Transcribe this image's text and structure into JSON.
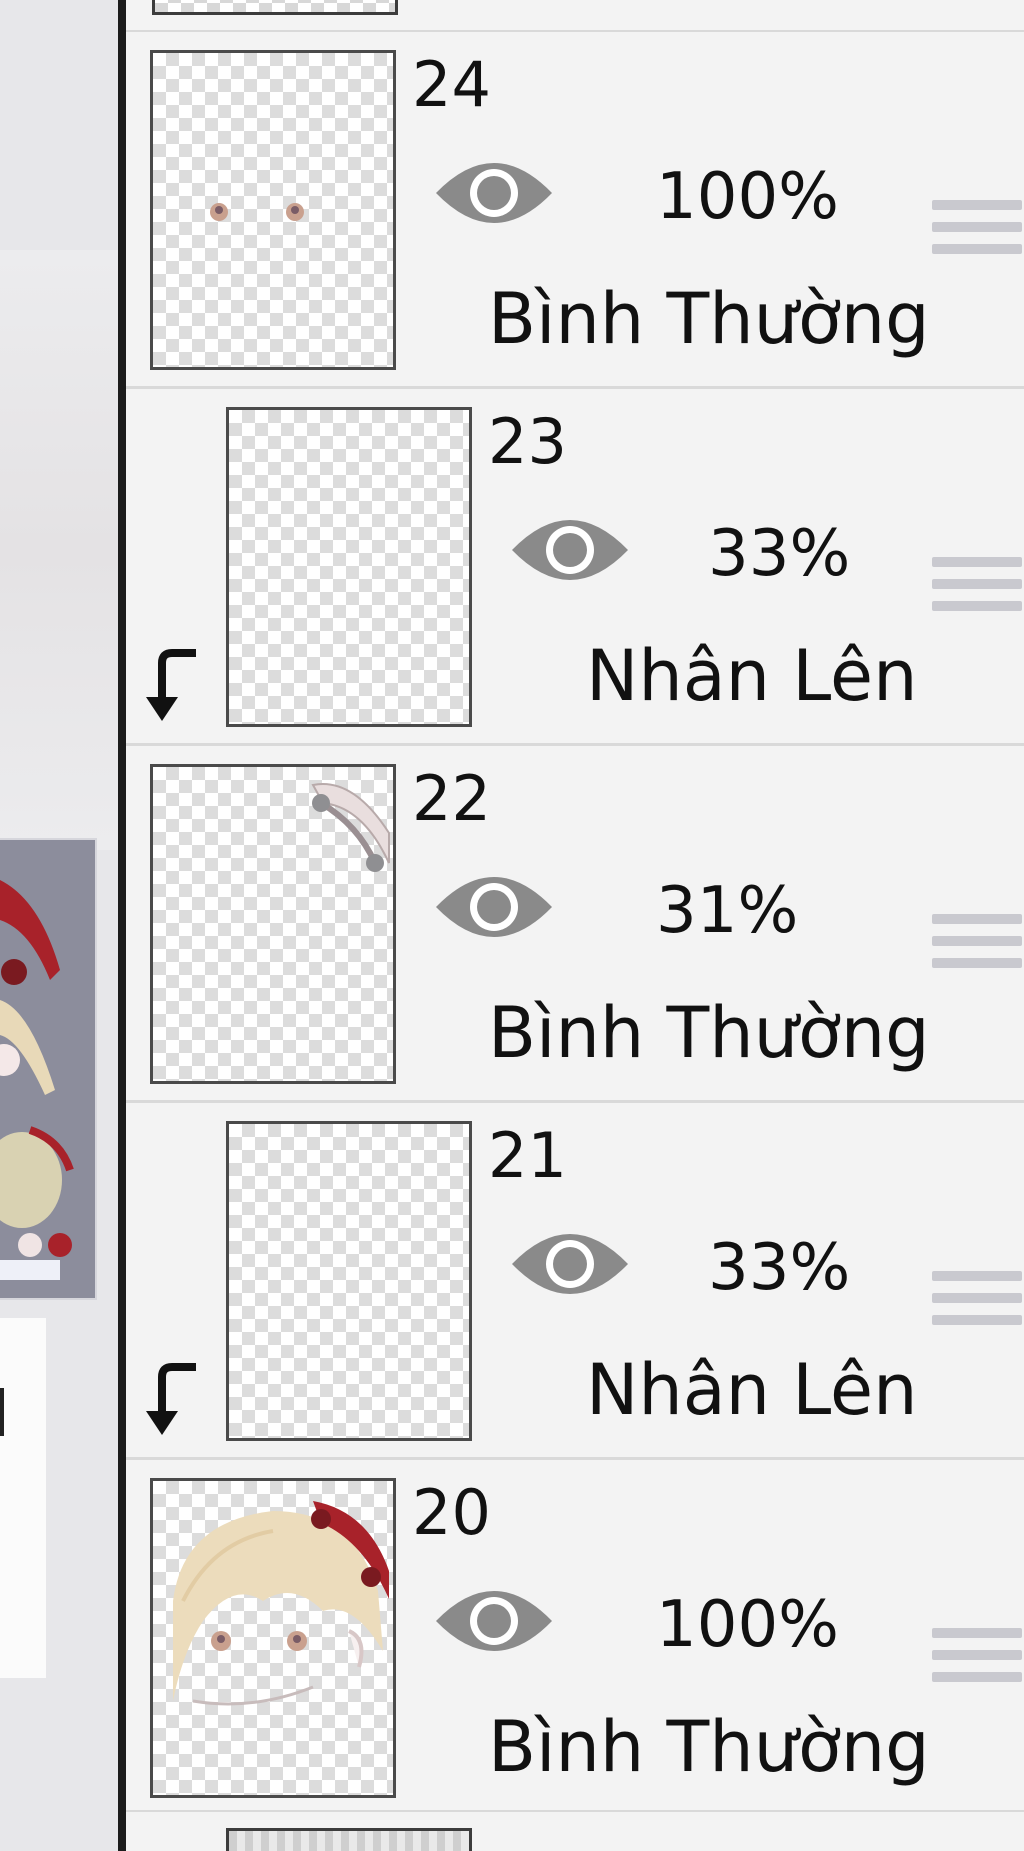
{
  "layers": [
    {
      "number": "24",
      "opacity": "100%",
      "blend": "Bình Thường",
      "clipped": false,
      "visible": true
    },
    {
      "number": "23",
      "opacity": "33%",
      "blend": "Nhân Lên",
      "clipped": true,
      "visible": true
    },
    {
      "number": "22",
      "opacity": "31%",
      "blend": "Bình Thường",
      "clipped": false,
      "visible": true
    },
    {
      "number": "21",
      "opacity": "33%",
      "blend": "Nhân Lên",
      "clipped": true,
      "visible": true
    },
    {
      "number": "20",
      "opacity": "100%",
      "blend": "Bình Thường",
      "clipped": false,
      "visible": true
    }
  ],
  "colors": {
    "panel_bg": "#f3f3f3",
    "eye": "#8a8a8a",
    "handle": "#c9c9cf",
    "thumb_border": "#4a4a4a",
    "canvas_preview": "#8c8d9c",
    "accent_red": "#a8222a"
  },
  "icons": {
    "visibility": "eye-icon",
    "reorder": "drag-handle-icon",
    "clipping": "clipping-arrow-icon"
  }
}
